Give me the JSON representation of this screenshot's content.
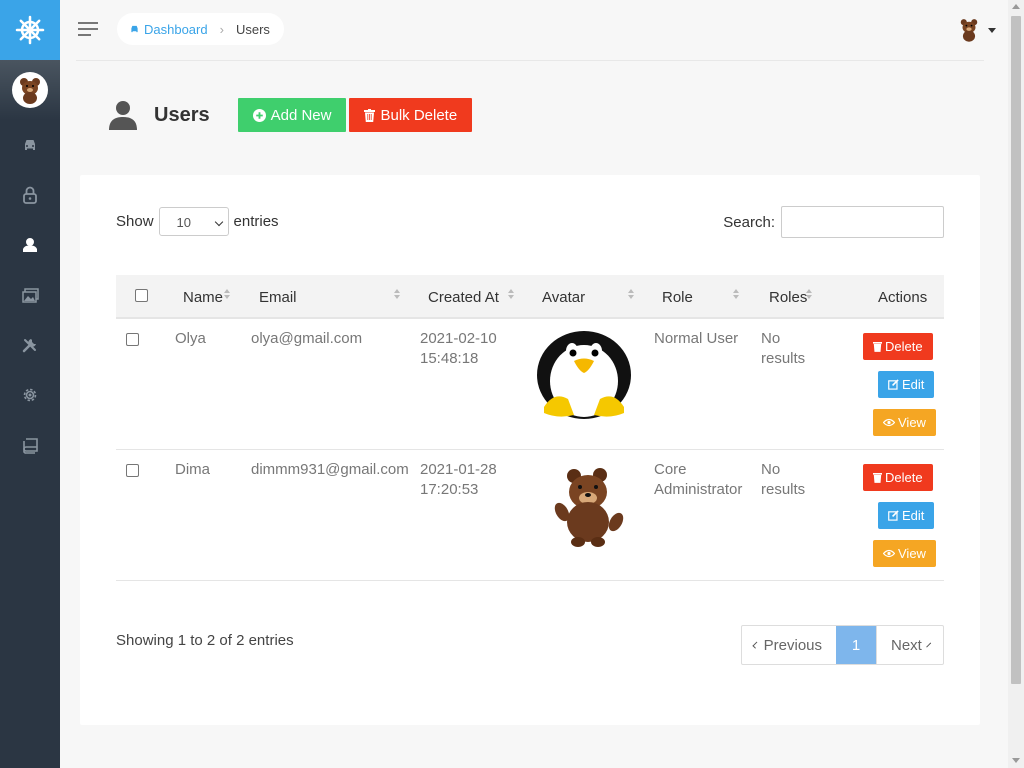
{
  "breadcrumb": {
    "home": "Dashboard",
    "current": "Users"
  },
  "page": {
    "title": "Users",
    "add_new": "Add New",
    "bulk_delete": "Bulk Delete"
  },
  "table_controls": {
    "show": "Show",
    "entries_value": "10",
    "entries": "entries",
    "search": "Search:"
  },
  "columns": [
    "Name",
    "Email",
    "Created At",
    "Avatar",
    "Role",
    "Roles",
    "Actions"
  ],
  "rows": [
    {
      "name": "Olya",
      "email": "olya@gmail.com",
      "created_date": "2021-02-10",
      "created_time": "15:48:18",
      "avatar": "penguin-avatar",
      "role": "Normal User",
      "role_line2": "",
      "roles_1": "No",
      "roles_2": "results"
    },
    {
      "name": "Dima",
      "email": "dimmm931@gmail.com",
      "created_date": "2021-01-28",
      "created_time": "17:20:53",
      "avatar": "bear-avatar",
      "role": "Core",
      "role_line2": "Administrator",
      "roles_1": "No",
      "roles_2": "results"
    }
  ],
  "actions": {
    "delete": "Delete",
    "edit": "Edit",
    "view": "View"
  },
  "footer": {
    "info": "Showing 1 to 2 of 2 entries",
    "previous": "Previous",
    "page": "1",
    "next": "Next"
  },
  "colors": {
    "accent": "#3aa4e8",
    "sidebar": "#2b3643",
    "add": "#3fcf6d",
    "delete": "#f03a1e",
    "view": "#f5a623"
  },
  "sidebar_icons": [
    "car-icon",
    "lock-icon",
    "user-icon",
    "images-icon",
    "tools-icon",
    "gear-icon",
    "book-icon"
  ]
}
